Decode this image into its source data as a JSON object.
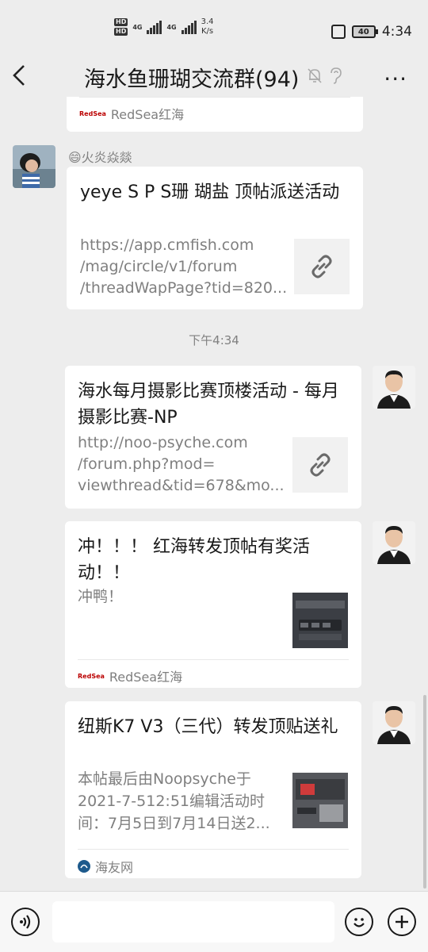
{
  "status_bar": {
    "hd1": "HD",
    "hd2": "HD",
    "net1": "4G",
    "net2": "4G",
    "speed_value": "3.4",
    "speed_unit": "K/s",
    "battery": "40",
    "time": "4:34"
  },
  "header": {
    "title": "海水鱼珊瑚交流群(94)",
    "more": "..."
  },
  "messages": {
    "top_card": {
      "source_logo": "RedSea",
      "source": "RedSea红海"
    },
    "msg1": {
      "sender": "😄火炎焱燚",
      "title": "yeye S P S珊 瑚盐 顶帖派送活动",
      "desc_lines": [
        "https://app.cmfish.com",
        "/mag/circle/v1/forum",
        "/threadWapPage?tid=820..."
      ]
    },
    "timestamp": "下午4:34",
    "msg2": {
      "title": "海水每月摄影比赛顶楼活动 - 每月摄影比赛-NP",
      "desc_lines": [
        "http://noo-psyche.com",
        "/forum.php?mod=",
        "viewthread&tid=678&mo..."
      ]
    },
    "msg3": {
      "title": "冲！！！ 红海转发顶帖有奖活动！！",
      "desc": "冲鸭！",
      "source_logo": "RedSea",
      "source": "RedSea红海"
    },
    "msg4": {
      "title": "纽斯K7 V3（三代）转发顶贴送礼",
      "desc_lines": [
        "本帖最后由Noopsyche于",
        "2021-7-512:51编辑活动时",
        "间：7月5日到7月14日送2..."
      ],
      "source": "海友网"
    }
  },
  "input_bar": {
    "placeholder": ""
  },
  "colors": {
    "background": "#ededed",
    "card": "#ffffff",
    "secondary_text": "#7f7f7f"
  }
}
